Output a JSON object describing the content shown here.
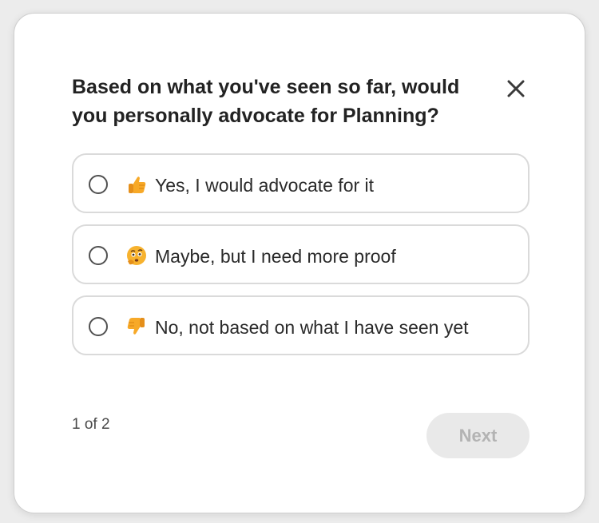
{
  "survey": {
    "question": "Based on what you've seen so far, would you personally advocate for Planning?",
    "close_icon": "close-icon",
    "options": [
      {
        "label": "Yes, I would advocate for it",
        "icon": "thumbs-up-icon",
        "selected": false
      },
      {
        "label": "Maybe, but I need more proof",
        "icon": "thinking-face-icon",
        "selected": false
      },
      {
        "label": "No, not based on what I have seen yet",
        "icon": "thumbs-down-icon",
        "selected": false
      }
    ],
    "step_text": "1 of 2",
    "next_label": "Next",
    "next_disabled": true
  },
  "colors": {
    "background": "#ececec",
    "card": "#ffffff",
    "text": "#222222",
    "border": "#dadada",
    "emoji": "#f7a928",
    "button_disabled_bg": "#e9e9e9",
    "button_disabled_text": "#b3b3b3"
  }
}
